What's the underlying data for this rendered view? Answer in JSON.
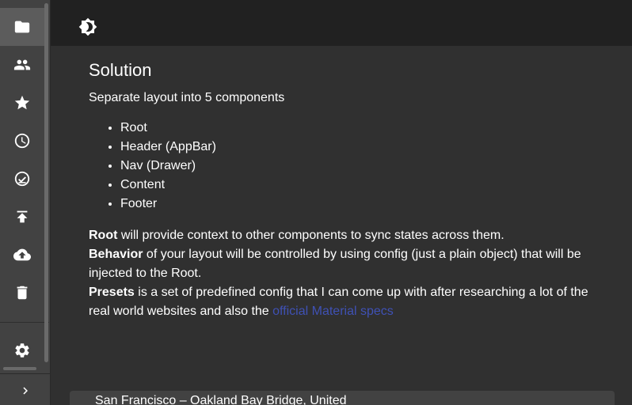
{
  "sidebar": {
    "items": [
      {
        "icon": "folder-icon",
        "active": true
      },
      {
        "icon": "people-icon",
        "active": false
      },
      {
        "icon": "star-icon",
        "active": false
      },
      {
        "icon": "clock-icon",
        "active": false
      },
      {
        "icon": "check-circle-icon",
        "active": false
      },
      {
        "icon": "publish-icon",
        "active": false
      },
      {
        "icon": "cloud-upload-icon",
        "active": false
      },
      {
        "icon": "trash-icon",
        "active": false
      }
    ],
    "settings_icon": "gear-icon",
    "collapse_icon": "chevron-right-icon"
  },
  "header": {
    "theme_icon": "brightness-icon"
  },
  "content": {
    "title": "Solution",
    "lead": "Separate layout into 5 components",
    "components": [
      "Root",
      "Header (AppBar)",
      "Nav (Drawer)",
      "Content",
      "Footer"
    ],
    "root_term": "Root",
    "root_desc": " will provide context to other components to sync states across them.",
    "behavior_term": "Behavior",
    "behavior_desc": " of your layout will be controlled by using config (just a plain object) that will be injected to the Root.",
    "presets_term": "Presets",
    "presets_desc": " is a set of predefined config that I can come up with after researching a lot of the real world websites and also the ",
    "link_text": "official Material specs"
  },
  "card": {
    "text": "San Francisco – Oakland Bay Bridge, United"
  },
  "colors": {
    "background": "#303030",
    "header": "#212121",
    "sidebar": "#424242",
    "link": "#3f51b5"
  }
}
